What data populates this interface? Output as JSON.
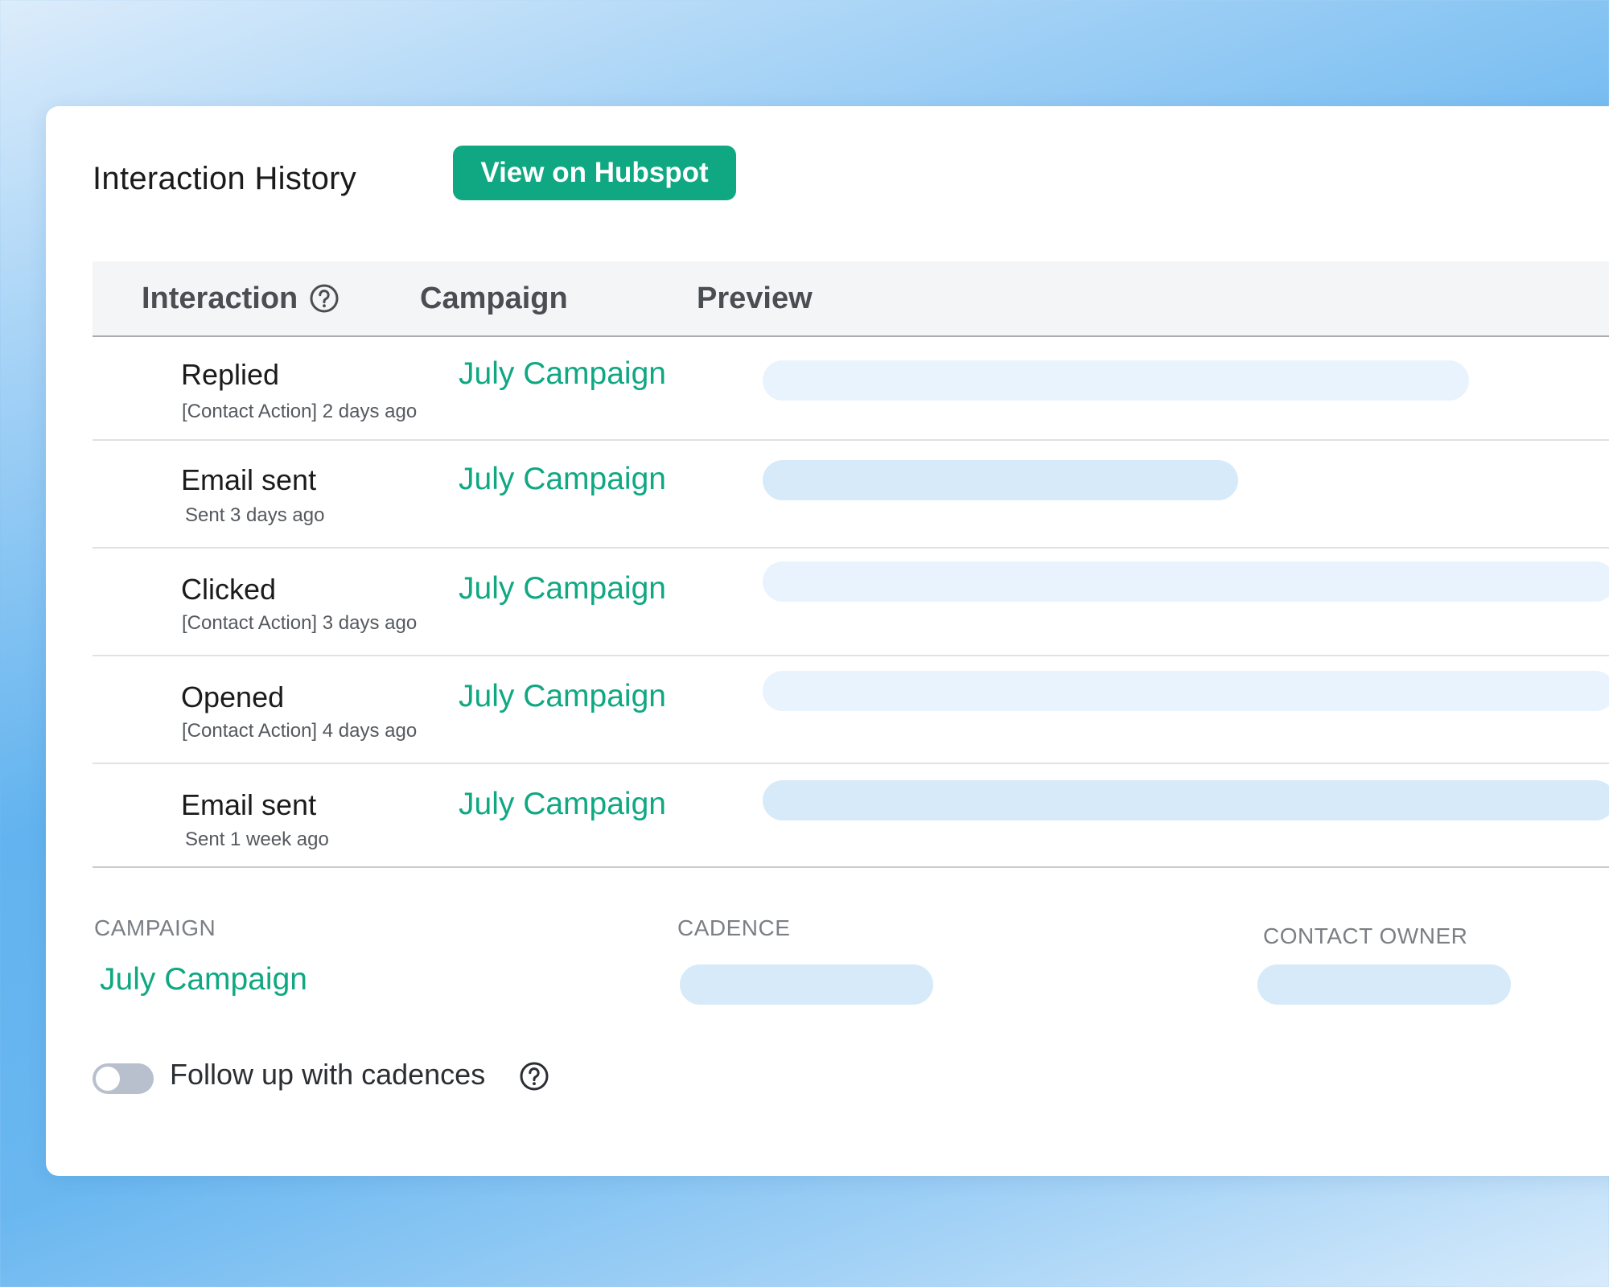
{
  "card": {
    "title": "Interaction History",
    "hubspot_button_label": "View on Hubspot"
  },
  "table": {
    "headers": {
      "interaction": "Interaction",
      "campaign": "Campaign",
      "preview": "Preview"
    },
    "rows": [
      {
        "type": "Replied",
        "detail": "[Contact Action] 2 days ago",
        "campaign": "July Campaign"
      },
      {
        "type": "Email sent",
        "detail": "Sent 3 days ago",
        "campaign": "July Campaign"
      },
      {
        "type": "Clicked",
        "detail": "[Contact Action] 3 days ago",
        "campaign": "July Campaign"
      },
      {
        "type": "Opened",
        "detail": "[Contact Action] 4 days ago",
        "campaign": "July Campaign"
      },
      {
        "type": "Email sent",
        "detail": "Sent 1 week ago",
        "campaign": "July Campaign"
      }
    ]
  },
  "footer": {
    "campaign_label": "CAMPAIGN",
    "campaign_value": "July Campaign",
    "cadence_label": "CADENCE",
    "contact_owner_label": "CONTACT OWNER",
    "follow_up_label": "Follow up with cadences",
    "follow_up_enabled": false
  },
  "colors": {
    "accent": "#0fa882",
    "placeholder_light": "#e9f3fd",
    "placeholder_mid": "#d6eaf9"
  },
  "icons": {
    "help": "question-circle-icon"
  }
}
